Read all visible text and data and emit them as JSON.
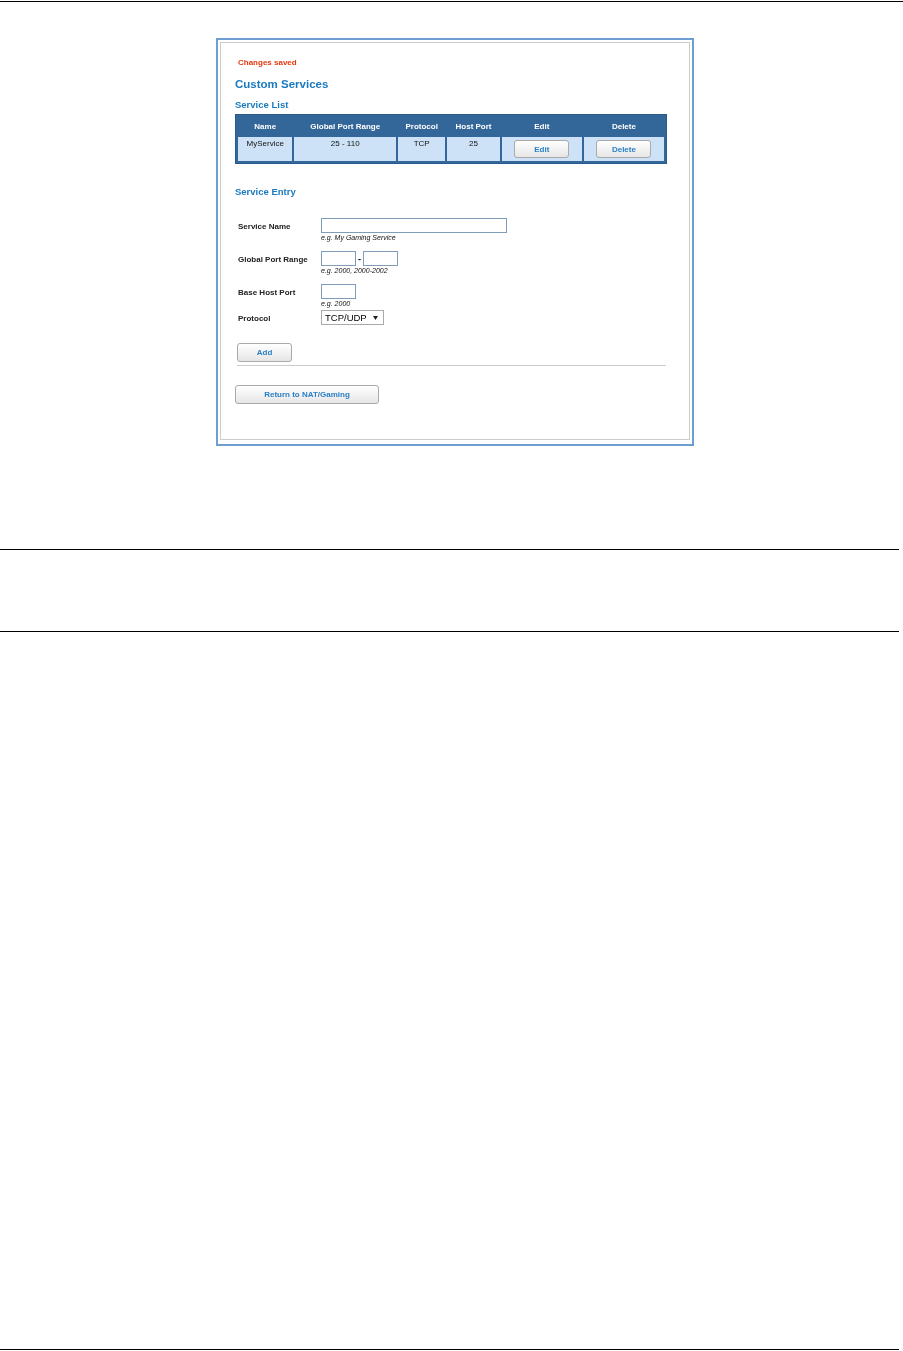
{
  "status_message": "Changes saved",
  "title": "Custom Services",
  "service_list": {
    "heading": "Service List",
    "columns": [
      "Name",
      "Global Port Range",
      "Protocol",
      "Host Port",
      "Edit",
      "Delete"
    ],
    "rows": [
      {
        "cells": [
          "MyService",
          "25 - 110",
          "TCP",
          "25"
        ],
        "actions": [
          "Edit",
          "Delete"
        ]
      }
    ]
  },
  "service_entry": {
    "heading": "Service Entry",
    "fields": [
      {
        "kind": "text",
        "label": "Service Name",
        "hint": "e.g. My Gaming Service"
      },
      {
        "kind": "range",
        "label": "Global Port Range",
        "separator": "-",
        "hint": "e.g. 2000, 2000-2002"
      },
      {
        "kind": "port",
        "label": "Base Host Port",
        "hint": "e.g. 2000"
      },
      {
        "kind": "select",
        "label": "Protocol",
        "value": "TCP/UDP"
      }
    ],
    "add_button": "Add"
  },
  "return_button": "Return to NAT/Gaming"
}
